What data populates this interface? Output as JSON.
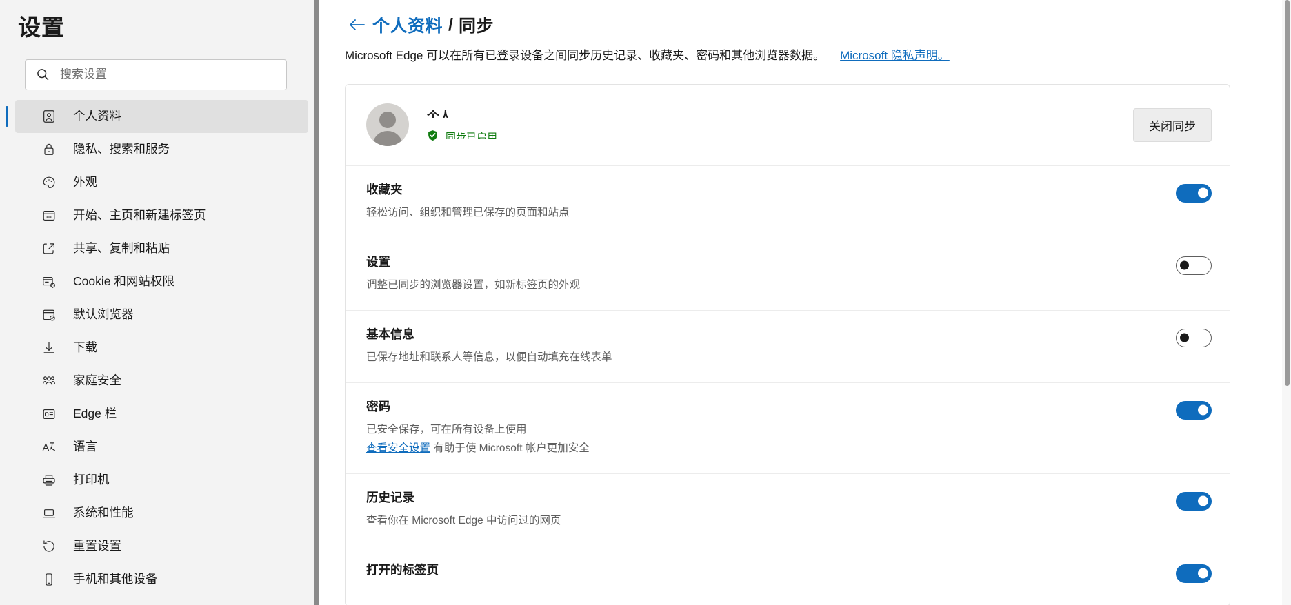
{
  "sidebar": {
    "title": "设置",
    "search": {
      "placeholder": "搜索设置",
      "value": "",
      "icon": "search-icon"
    },
    "items": [
      {
        "label": "个人资料",
        "icon": "profile-icon",
        "selected": true
      },
      {
        "label": "隐私、搜索和服务",
        "icon": "lock-icon",
        "selected": false
      },
      {
        "label": "外观",
        "icon": "palette-icon",
        "selected": false
      },
      {
        "label": "开始、主页和新建标签页",
        "icon": "new-tab-icon",
        "selected": false
      },
      {
        "label": "共享、复制和粘贴",
        "icon": "share-icon",
        "selected": false
      },
      {
        "label": "Cookie 和网站权限",
        "icon": "cookie-settings-icon",
        "selected": false
      },
      {
        "label": "默认浏览器",
        "icon": "default-browser-icon",
        "selected": false
      },
      {
        "label": "下载",
        "icon": "download-icon",
        "selected": false
      },
      {
        "label": "家庭安全",
        "icon": "family-icon",
        "selected": false
      },
      {
        "label": "Edge 栏",
        "icon": "edge-bar-icon",
        "selected": false
      },
      {
        "label": "语言",
        "icon": "language-icon",
        "selected": false
      },
      {
        "label": "打印机",
        "icon": "printer-icon",
        "selected": false
      },
      {
        "label": "系统和性能",
        "icon": "laptop-icon",
        "selected": false
      },
      {
        "label": "重置设置",
        "icon": "reset-icon",
        "selected": false
      },
      {
        "label": "手机和其他设备",
        "icon": "phone-icon",
        "selected": false
      }
    ]
  },
  "main": {
    "breadcrumb": {
      "back_icon": "back-arrow-icon",
      "parent": "个人资料",
      "separator": "/",
      "current": "同步"
    },
    "description": {
      "text": "Microsoft Edge 可以在所有已登录设备之间同步历史记录、收藏夹、密码和其他浏览器数据。",
      "link": "Microsoft 隐私声明。"
    },
    "profile": {
      "avatar_icon": "avatar-icon",
      "name": "个人",
      "status_icon": "shield-check-icon",
      "status_text": "同步已启用",
      "status_color": "#107c10",
      "turn_off_label": "关闭同步"
    },
    "sync_items": [
      {
        "title": "收藏夹",
        "desc": "轻松访问、组织和管理已保存的页面和站点",
        "desc2": null,
        "link": null,
        "link_suffix": null,
        "enabled": true
      },
      {
        "title": "设置",
        "desc": "调整已同步的浏览器设置，如新标签页的外观",
        "desc2": null,
        "link": null,
        "link_suffix": null,
        "enabled": false
      },
      {
        "title": "基本信息",
        "desc": "已保存地址和联系人等信息，以便自动填充在线表单",
        "desc2": null,
        "link": null,
        "link_suffix": null,
        "enabled": false
      },
      {
        "title": "密码",
        "desc": "已安全保存，可在所有设备上使用",
        "desc2": null,
        "link": "查看安全设置",
        "link_suffix": " 有助于使 Microsoft 帐户更加安全",
        "enabled": true
      },
      {
        "title": "历史记录",
        "desc": "查看你在 Microsoft Edge 中访问过的网页",
        "desc2": null,
        "link": null,
        "link_suffix": null,
        "enabled": true
      },
      {
        "title": "打开的标签页",
        "desc": "",
        "desc2": null,
        "link": null,
        "link_suffix": null,
        "enabled": true
      }
    ]
  },
  "colors": {
    "accent": "#0f6cbd",
    "success": "#107c10",
    "sidebar_bg": "#f3f3f3",
    "divider": "#8a8a8a"
  }
}
